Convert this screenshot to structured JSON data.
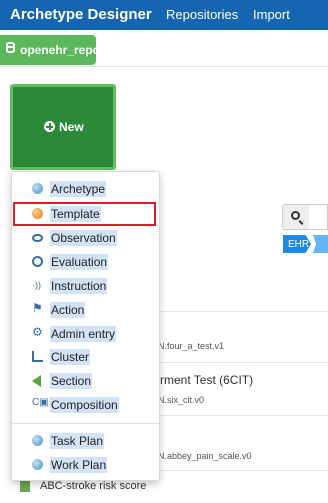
{
  "header": {
    "brand": "Archetype Designer",
    "nav": [
      "Repositories",
      "Import"
    ]
  },
  "repo_tab": {
    "label": "openehr_repo"
  },
  "new_button": {
    "label": "New"
  },
  "menu": {
    "items": [
      {
        "label": "Archetype",
        "icon": "sphere-icon"
      },
      {
        "label": "Template",
        "icon": "orange-sphere-icon"
      },
      {
        "label": "Observation",
        "icon": "eye-icon"
      },
      {
        "label": "Evaluation",
        "icon": "cycle-icon"
      },
      {
        "label": "Instruction",
        "icon": "signal-icon"
      },
      {
        "label": "Action",
        "icon": "signpost-icon"
      },
      {
        "label": "Admin entry",
        "icon": "gear-icon"
      },
      {
        "label": "Cluster",
        "icon": "tree-icon"
      },
      {
        "label": "Section",
        "icon": "chevron-left-icon"
      },
      {
        "label": "Composition",
        "icon": "composition-icon"
      }
    ],
    "items2": [
      {
        "label": "Task Plan",
        "icon": "sphere-icon"
      },
      {
        "label": "Work Plan",
        "icon": "sphere-icon"
      }
    ]
  },
  "breadcrumb": {
    "chip": "EHR"
  },
  "list": {
    "rows": [
      {
        "title": "",
        "sub": "N.four_a_test.v1"
      },
      {
        "title": "rment Test (6CIT)",
        "sub": "N.six_cit.v0"
      },
      {
        "title": "",
        "sub": "N.abbey_pain_scale.v0"
      }
    ],
    "bottom_item": "ABC-stroke risk score"
  },
  "colors": {
    "topbar": "#1565b0",
    "repo_tab": "#5cb85c",
    "new_button": "#2a8a3a",
    "highlight": "#d9202a"
  }
}
